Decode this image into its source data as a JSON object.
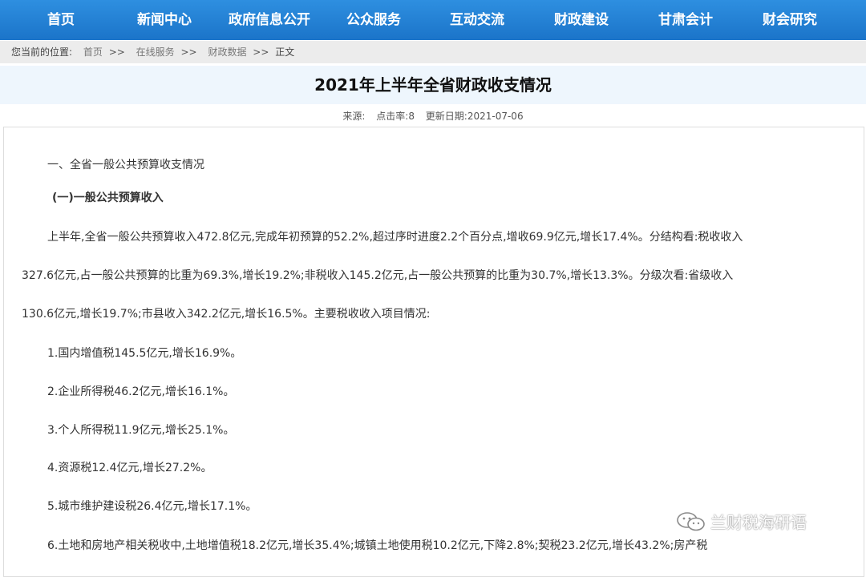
{
  "nav": {
    "items": [
      "首页",
      "新闻中心",
      "政府信息公开",
      "公众服务",
      "互动交流",
      "财政建设",
      "甘肃会计",
      "财会研究"
    ]
  },
  "breadcrumb": {
    "lead": "您当前的位置:",
    "links": [
      "首页",
      "在线服务",
      "财政数据"
    ],
    "separator": ">>",
    "current": "正文"
  },
  "article": {
    "title": "2021年上半年全省财政收支情况",
    "meta": {
      "source": "来源:",
      "hits": "点击率:8",
      "updated": "更新日期:2021-07-06"
    },
    "section_heading": "一、全省一般公共预算收支情况",
    "sub_heading": "(一)一般公共预算收入",
    "paragraph_lines": [
      "上半年,全省一般公共预算收入472.8亿元,完成年初预算的52.2%,超过序时进度2.2个百分点,增收69.9亿元,增长17.4%。分结构看:税收收入",
      "327.6亿元,占一般公共预算的比重为69.3%,增长19.2%;非税收入145.2亿元,占一般公共预算的比重为30.7%,增长13.3%。分级次看:省级收入",
      "130.6亿元,增长19.7%;市县收入342.2亿元,增长16.5%。主要税收收入项目情况:"
    ],
    "items": [
      "1.国内增值税145.5亿元,增长16.9%。",
      "2.企业所得税46.2亿元,增长16.1%。",
      "3.个人所得税11.9亿元,增长25.1%。",
      "4.资源税12.4亿元,增长27.2%。",
      "5.城市维护建设税26.4亿元,增长17.1%。",
      "6.土地和房地产相关税收中,土地增值税18.2亿元,增长35.4%;城镇土地使用税10.2亿元,下降2.8%;契税23.2亿元,增长43.2%;房产税"
    ]
  },
  "watermark": {
    "icon": "wechat-icon",
    "text": "兰财税海研语"
  }
}
